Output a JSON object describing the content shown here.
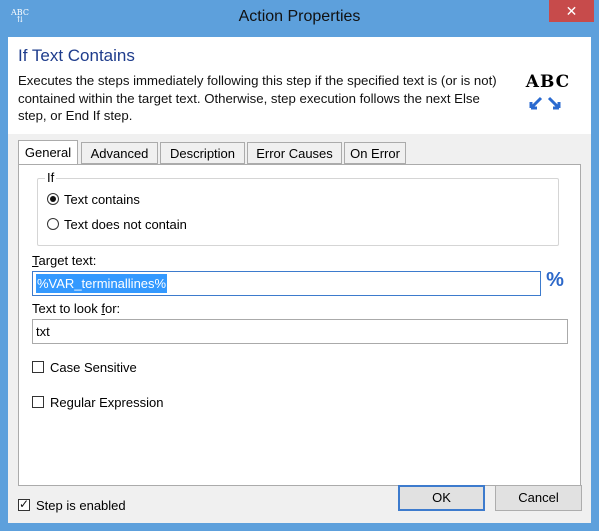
{
  "window": {
    "title": "Action Properties",
    "app_icon_text": "ABC",
    "close_label": "✕"
  },
  "header": {
    "title": "If Text Contains",
    "description": "Executes the steps immediately following this step if the specified text is (or is not)  contained within the target text.  Otherwise, step execution follows the next Else step, or End If step.",
    "icon_text": "ABC"
  },
  "tabs": [
    {
      "label": "General",
      "active": true
    },
    {
      "label": "Advanced",
      "active": false
    },
    {
      "label": "Description",
      "active": false
    },
    {
      "label": "Error Causes",
      "active": false
    },
    {
      "label": "On Error",
      "active": false
    }
  ],
  "general": {
    "group_label": "If",
    "options": [
      {
        "label": "Text contains",
        "selected": true
      },
      {
        "label": "Text does not contain",
        "selected": false
      }
    ],
    "target_text": {
      "label_hotkey": "T",
      "label_rest": "arget text:",
      "value": "%VAR_terminallines%"
    },
    "variable_icon": "%",
    "look_for": {
      "label_pre": "Text to look ",
      "label_hotkey": "f",
      "label_rest": "or:",
      "value": "txt"
    },
    "case_sensitive": {
      "label": "Case Sensitive",
      "checked": false
    },
    "regular_expression": {
      "label": "Regular Expression",
      "checked": false
    }
  },
  "footer": {
    "step_enabled": {
      "label": "Step is enabled",
      "checked": true
    },
    "ok_label": "OK",
    "cancel_label": "Cancel"
  }
}
